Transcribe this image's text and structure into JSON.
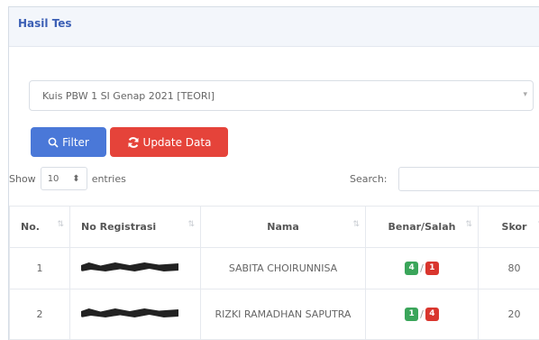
{
  "card": {
    "title": "Hasil Tes"
  },
  "filter_select": {
    "value": "Kuis PBW 1 SI Genap 2021 [TEORI]"
  },
  "buttons": {
    "filter": "Filter",
    "update": "Update Data"
  },
  "length": {
    "show": "Show",
    "value": "10",
    "entries": "entries"
  },
  "search": {
    "label": "Search:"
  },
  "table": {
    "columns": [
      "No.",
      "No Registrasi",
      "Nama",
      "Benar/Salah",
      "Skor"
    ],
    "rows": [
      {
        "no": "1",
        "nama": "SABITA CHOIRUNNISA",
        "benar": "4",
        "salah": "1",
        "skor": "80"
      },
      {
        "no": "2",
        "nama": "RIZKI RAMADHAN SAPUTRA",
        "benar": "1",
        "salah": "4",
        "skor": "20"
      }
    ]
  },
  "colors": {
    "primary": "#4a78d8",
    "danger": "#e5433a",
    "success": "#3aa55a"
  }
}
